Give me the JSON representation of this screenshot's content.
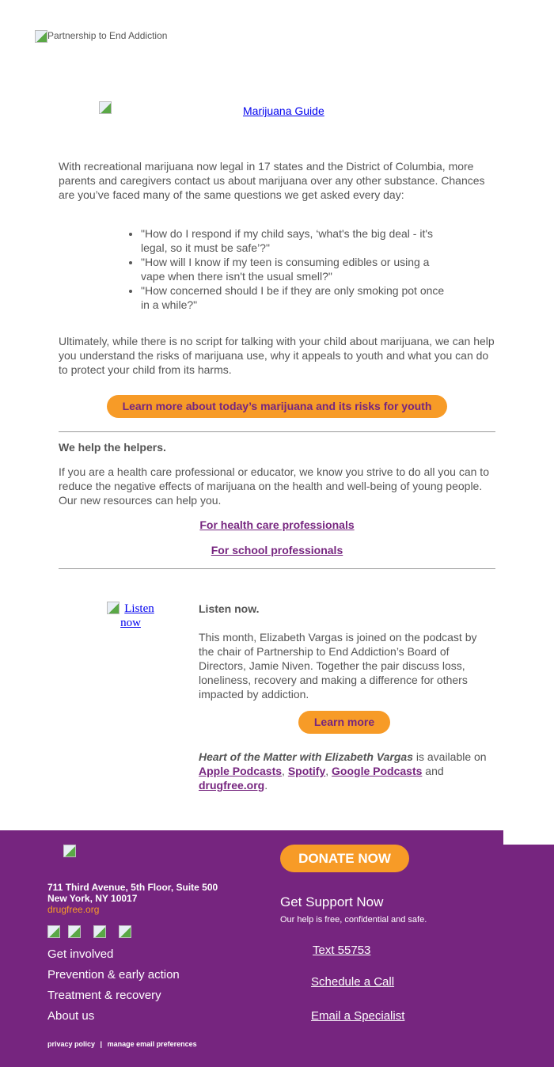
{
  "header": {
    "logo_alt": "Partnership to End Addiction",
    "guide_alt": "Marijuana Guide"
  },
  "intro": {
    "paragraph": "With recreational marijuana now legal in 17 states and the District of Columbia, more parents and caregivers contact us about marijuana over any other substance. Chances are you’ve faced many of the same questions we get asked every day:",
    "questions": [
      "\"How do I respond if my child says, ‘what's the big deal - it's legal, so it must be safe’?\"",
      "\"How will I know if my teen is consuming edibles or using a vape when there isn't the usual smell?\"",
      "\"How concerned should I be if they are only smoking pot once in a while?\""
    ],
    "closing": "Ultimately, while there is no script for talking with your child about marijuana, we can help you understand the risks of marijuana use, why it appeals to youth and what you can do to protect your child from its harms.",
    "cta": "Learn more about today’s marijuana and its risks for youth"
  },
  "helpers": {
    "heading": "We help the helpers.",
    "paragraph": "If you are a health care professional or educator, we know you strive to do all you can to reduce the negative effects of marijuana on the health and well-being of young people. Our new resources can help you.",
    "links": [
      "For health care professionals",
      "For school professionals"
    ]
  },
  "podcast": {
    "image_alt": "Listen now",
    "heading": "Listen now.",
    "paragraph": "This month, Elizabeth Vargas is joined on the podcast by the chair of Partnership to End Addiction’s Board of Directors, Jamie Niven. Together the pair discuss loss, loneliness, recovery and making a difference for others impacted by addiction.",
    "cta": "Learn more",
    "show_title": "Heart of the Matter with Elizabeth Vargas",
    "available_text": " is available on ",
    "platforms": [
      "Apple Podcasts",
      "Spotify",
      "Google Podcasts",
      "drugfree.org"
    ],
    "sep1": ", ",
    "sep2": ", ",
    "and": " and ",
    "end": "."
  },
  "footer": {
    "address1": "711 Third Avenue, 5th Floor, Suite 500",
    "address2": "New York, NY 10017",
    "site": "drugfree.org",
    "nav": [
      "Get involved",
      "Prevention & early action",
      "Treatment & recovery",
      "About us"
    ],
    "privacy": "privacy policy",
    "divider": "|",
    "prefs": "manage email preferences",
    "donate": "DONATE NOW",
    "support_title": "Get Support Now",
    "support_sub": "Our help is free, confidential and safe.",
    "support_links": [
      "Text 55753",
      "Schedule a Call",
      "Email a Specialist"
    ]
  },
  "colors": {
    "brand_purple": "#76257f",
    "accent_orange": "#f79b27",
    "body_text": "#555555"
  }
}
